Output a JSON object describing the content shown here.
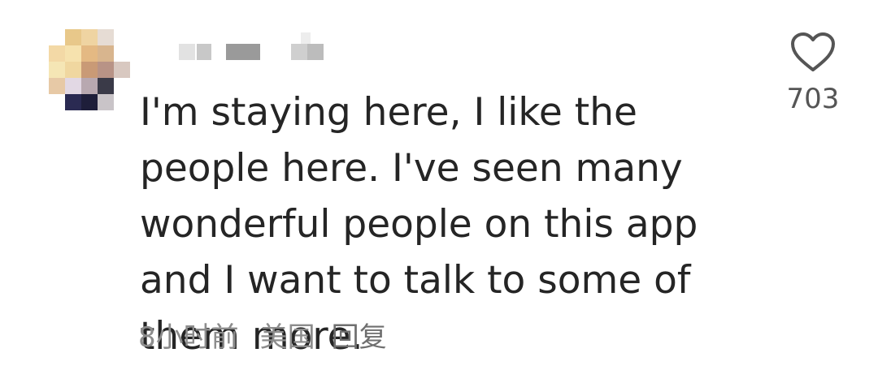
{
  "comment": {
    "username": "",
    "text": "I'm staying here, I like the people here. I've seen many wonderful people on this app and I want to talk to some of them more.",
    "time": "8小时前",
    "location": "美国",
    "reply_label": "回复"
  },
  "like": {
    "icon": "heart-outline-icon",
    "count": "703"
  },
  "colors": {
    "text": "#252525",
    "meta": "#8c8c8c",
    "icon": "#555555"
  }
}
